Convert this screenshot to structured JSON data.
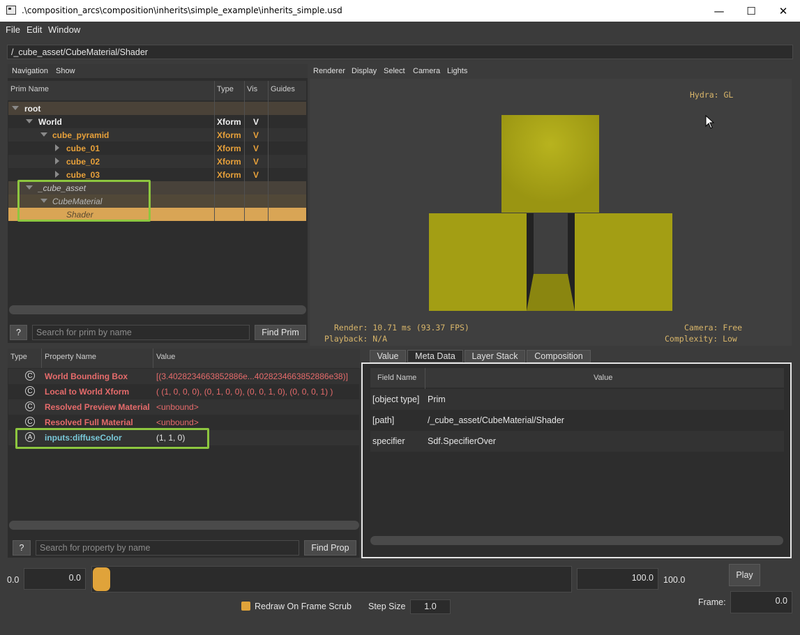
{
  "window": {
    "title": ".\\composition_arcs\\composition\\inherits\\simple_example\\inherits_simple.usd",
    "minimize_glyph": "—",
    "maximize_glyph": "☐",
    "close_glyph": "✕"
  },
  "menu": [
    "File",
    "Edit",
    "Window"
  ],
  "path": "/_cube_asset/CubeMaterial/Shader",
  "prim_panel": {
    "toolbar": [
      "Navigation",
      "Show"
    ],
    "columns": [
      "Prim Name",
      "Type",
      "Vis",
      "Guides"
    ],
    "rows": [
      {
        "name": "root",
        "type": "",
        "vis": ""
      },
      {
        "name": "World",
        "type": "Xform",
        "vis": "V"
      },
      {
        "name": "cube_pyramid",
        "type": "Xform",
        "vis": "V"
      },
      {
        "name": "cube_01",
        "type": "Xform",
        "vis": "V"
      },
      {
        "name": "cube_02",
        "type": "Xform",
        "vis": "V"
      },
      {
        "name": "cube_03",
        "type": "Xform",
        "vis": "V"
      },
      {
        "name": "_cube_asset",
        "type": "",
        "vis": ""
      },
      {
        "name": "CubeMaterial",
        "type": "",
        "vis": ""
      },
      {
        "name": "Shader",
        "type": "",
        "vis": ""
      }
    ],
    "help_label": "?",
    "search_placeholder": "Search for prim by name",
    "find_label": "Find Prim"
  },
  "viewport": {
    "toolbar": [
      "Renderer",
      "Display",
      "Select",
      "Camera",
      "Lights"
    ],
    "hydra": "Hydra: GL",
    "render": "Render: 10.71 ms (93.37 FPS)",
    "playback": "Playback: N/A",
    "camera": "Camera: Free",
    "complexity": "Complexity: Low",
    "colors": {
      "cube": "#9e9a12",
      "background": "#3f3f3f"
    }
  },
  "property_panel": {
    "columns": [
      "Type",
      "Property Name",
      "Value"
    ],
    "rows": [
      {
        "icon": "C",
        "name": "World Bounding Box",
        "value": "[(3.4028234663852886e...4028234663852886e38)]"
      },
      {
        "icon": "C",
        "name": "Local to World Xform",
        "value": "( (1, 0, 0, 0), (0, 1, 0, 0), (0, 0, 1, 0), (0, 0, 0, 1) )"
      },
      {
        "icon": "C",
        "name": "Resolved Preview Material",
        "value": "<unbound>"
      },
      {
        "icon": "C",
        "name": "Resolved Full Material",
        "value": "<unbound>"
      },
      {
        "icon": "A",
        "name": "inputs:diffuseColor",
        "value": "(1, 1, 0)"
      }
    ],
    "help_label": "?",
    "search_placeholder": "Search for property by name",
    "find_label": "Find Prop"
  },
  "meta_panel": {
    "tabs": [
      "Value",
      "Meta Data",
      "Layer Stack",
      "Composition"
    ],
    "active_tab": "Meta Data",
    "columns": [
      "Field Name",
      "Value"
    ],
    "rows": [
      {
        "field": "[object type]",
        "value": "Prim"
      },
      {
        "field": "[path]",
        "value": "/_cube_asset/CubeMaterial/Shader"
      },
      {
        "field": "specifier",
        "value": "Sdf.SpecifierOver"
      }
    ]
  },
  "timeline": {
    "start_label": "0.0",
    "start_value": "0.0",
    "end_value": "100.0",
    "end_label": "100.0",
    "play_label": "Play",
    "redraw_label": "Redraw On Frame Scrub",
    "redraw_checked": true,
    "step_label": "Step Size",
    "step_value": "1.0",
    "frame_label": "Frame:",
    "frame_value": "0.0"
  }
}
